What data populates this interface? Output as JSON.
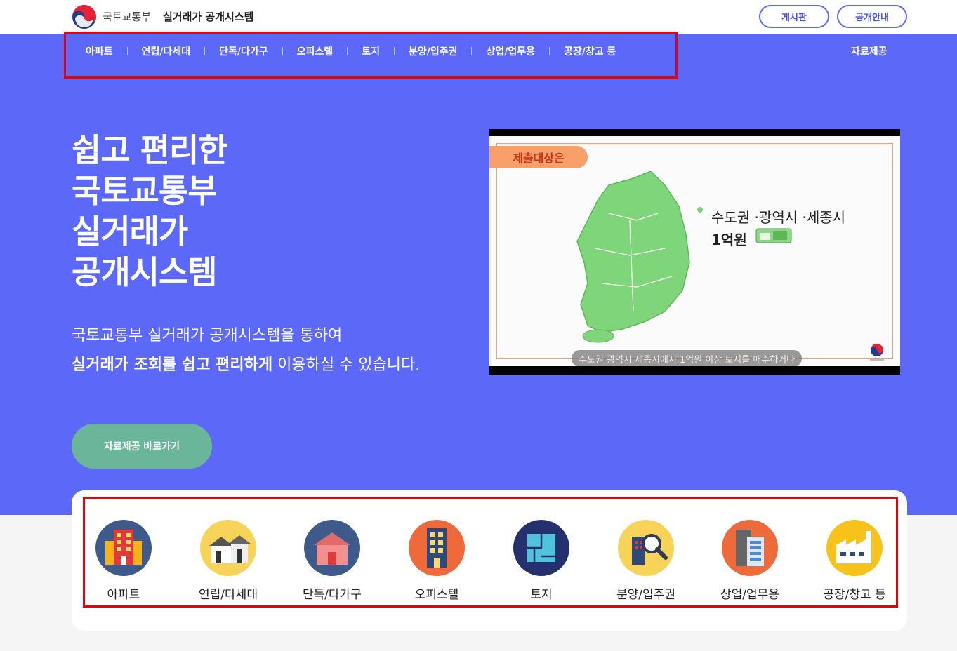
{
  "header": {
    "org_name": "국토교통부",
    "system_name": "실거래가 공개시스템",
    "buttons": [
      "게시판",
      "공개안내"
    ]
  },
  "nav": {
    "items": [
      "아파트",
      "연립/다세대",
      "단독/다가구",
      "오피스텔",
      "토지",
      "분양/입주권",
      "상업/업무용",
      "공장/창고 등"
    ],
    "right_item": "자료제공"
  },
  "hero": {
    "title_lines": [
      "쉽고 편리한",
      "국토교통부",
      "실거래가",
      "공개시스템"
    ],
    "desc_line1": "국토교통부 실거래가 공개시스템을 통하여",
    "desc_line2_bold": "실거래가 조회를 쉽고 편리하게",
    "desc_line2_rest": " 이용하실 수 있습니다.",
    "cta_label": "자료제공 바로가기"
  },
  "video": {
    "tag": "제출대상은",
    "text_line1": "수도권 ·광역시 ·세종시",
    "text_line2": "1억원",
    "subtitle": "수도권 광역시 세종시에서 1억원 이상 토지를 매수하거나"
  },
  "categories": [
    {
      "label": "아파트",
      "icon": "apartment-icon",
      "bg": "#3d5a8a"
    },
    {
      "label": "연립/다세대",
      "icon": "row-house-icon",
      "bg": "#f7d35a"
    },
    {
      "label": "단독/다가구",
      "icon": "detached-house-icon",
      "bg": "#3d5a8a"
    },
    {
      "label": "오피스텔",
      "icon": "officetel-icon",
      "bg": "#ef6a3a"
    },
    {
      "label": "토지",
      "icon": "land-icon",
      "bg": "#25316e"
    },
    {
      "label": "분양/입주권",
      "icon": "presale-search-icon",
      "bg": "#f7d35a"
    },
    {
      "label": "상업/업무용",
      "icon": "commercial-building-icon",
      "bg": "#ef6a3a"
    },
    {
      "label": "공장/창고 등",
      "icon": "factory-icon",
      "bg": "#f7c31a"
    }
  ]
}
